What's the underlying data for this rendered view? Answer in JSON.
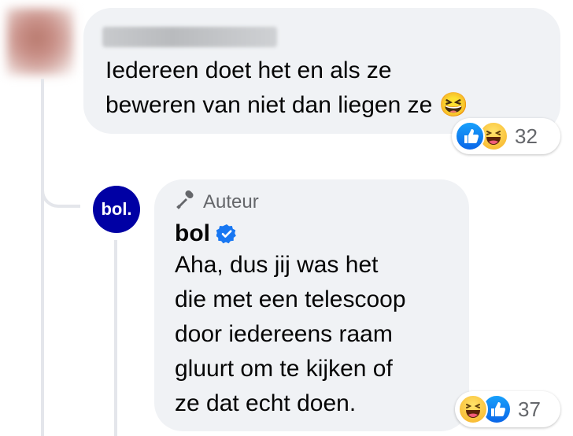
{
  "comment": {
    "author_name": "",
    "text_lines": [
      "Iedereen doet het en als ze",
      "beweren van niet dan liegen ze"
    ],
    "emoji": "😆",
    "reactions": {
      "types": [
        "like-icon",
        "haha-icon"
      ],
      "count": "32"
    }
  },
  "reply": {
    "avatar_text": "bol.",
    "author_badge": "Auteur",
    "author_name": "bol",
    "text_lines": [
      "Aha, dus jij was het",
      "die met een telescoop",
      "door iedereens raam",
      "gluurt om te kijken of",
      "ze dat echt doen."
    ],
    "reactions": {
      "types": [
        "haha-icon",
        "like-icon"
      ],
      "count": "37"
    }
  },
  "colors": {
    "bubble_bg": "#f0f2f5",
    "bol_brand": "#0000a4",
    "like_blue": "#0a66e8",
    "verified_blue": "#1877f2",
    "meta_gray": "#65676b"
  }
}
